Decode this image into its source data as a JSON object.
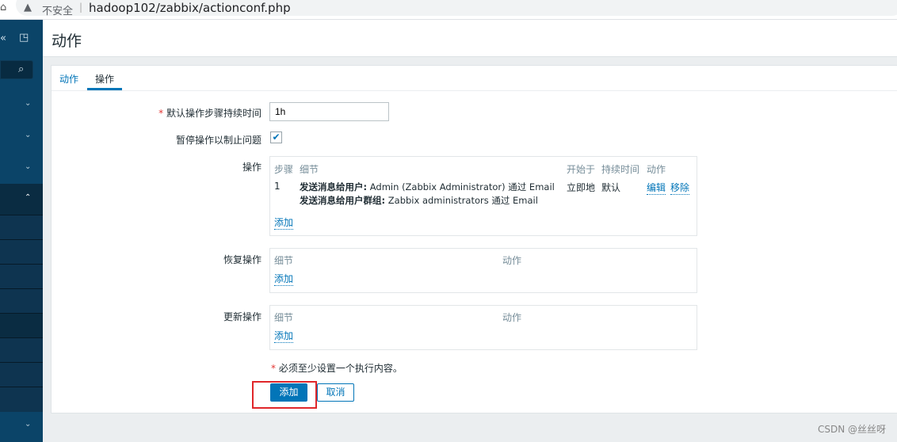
{
  "browser": {
    "insecure_label": "不安全",
    "url": "hadoop102/zabbix/actionconf.php"
  },
  "header": {
    "title": "动作"
  },
  "tabs": [
    {
      "label": "动作"
    },
    {
      "label": "操作"
    }
  ],
  "form": {
    "duration_label": "默认操作步骤持续时间",
    "duration_value": "1h",
    "required_mark": "*",
    "pause_label": "暂停操作以制止问题",
    "pause_checked": true,
    "operations": {
      "label": "操作",
      "headers": [
        "步骤",
        "细节",
        "开始于",
        "持续时间",
        "动作"
      ],
      "rows": [
        {
          "step": "1",
          "detail1_bold": "发送消息给用户:",
          "detail1": " Admin (Zabbix Administrator) 通过 Email",
          "detail2_bold": "发送消息给用户群组:",
          "detail2": " Zabbix administrators 通过 Email",
          "start": "立即地",
          "duration": "默认",
          "edit": "编辑",
          "remove": "移除"
        }
      ],
      "add": "添加"
    },
    "recovery": {
      "label": "恢复操作",
      "headers": [
        "细节",
        "动作"
      ],
      "add": "添加"
    },
    "update": {
      "label": "更新操作",
      "headers": [
        "细节",
        "动作"
      ],
      "add": "添加"
    },
    "note": "必须至少设置一个执行内容。",
    "add_button": "添加",
    "cancel_button": "取消"
  },
  "watermark": "CSDN @丝丝呀",
  "accent": "#0275b8"
}
